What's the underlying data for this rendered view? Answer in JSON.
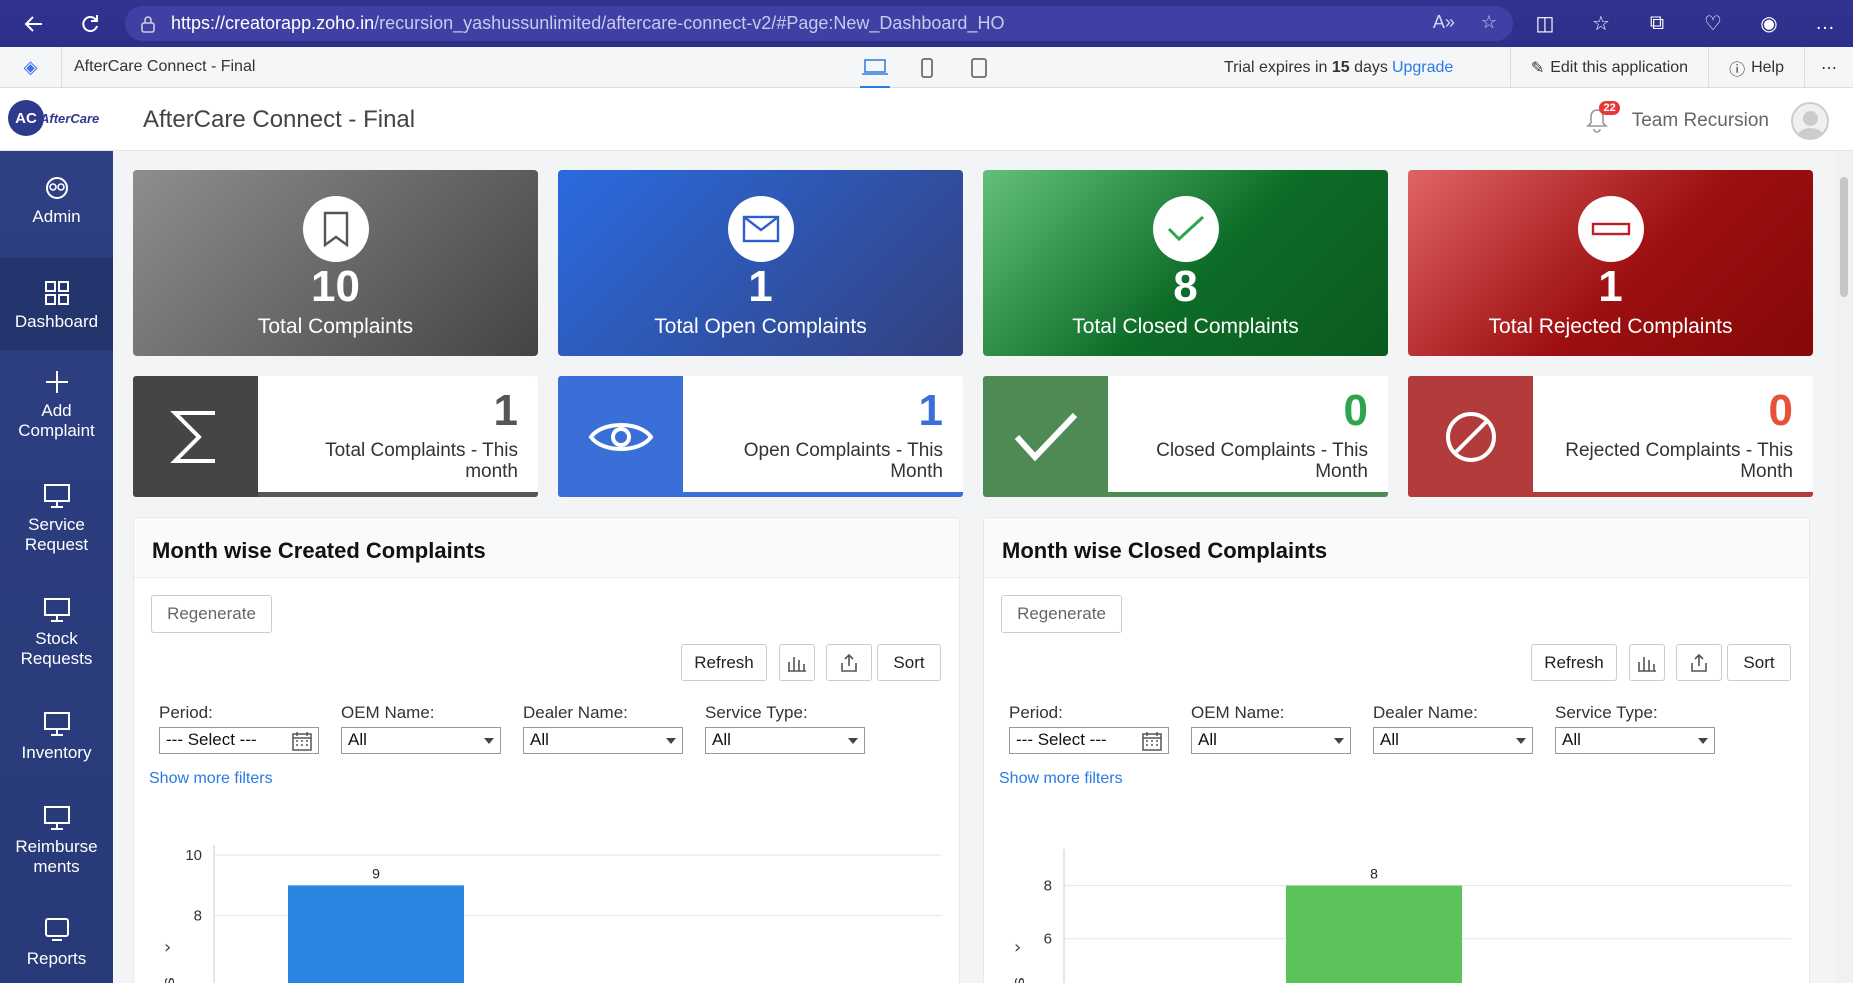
{
  "browser": {
    "url_host": "https://creatorapp.zoho.in",
    "url_path": "/recursion_yashussunlimited/aftercare-connect-v2/#Page:New_Dashboard_HO"
  },
  "zoho_bar": {
    "app_name": "AfterCare Connect - Final",
    "trial_prefix": "Trial expires in ",
    "trial_days": "15",
    "trial_suffix": " days",
    "upgrade": "Upgrade",
    "edit": "Edit this application",
    "help": "Help"
  },
  "header": {
    "logo_text": "AfterCare",
    "title": "AfterCare Connect - Final",
    "notif_count": "22",
    "user": "Team Recursion"
  },
  "sidebar": {
    "items": [
      {
        "label": "Admin",
        "icon": "admin-icon"
      },
      {
        "label": "Dashboard",
        "icon": "dashboard-icon"
      },
      {
        "label": "Add Complaint",
        "icon": "plus-icon"
      },
      {
        "label": "Service Request",
        "icon": "monitor-icon"
      },
      {
        "label": "Stock Requests",
        "icon": "monitor-icon"
      },
      {
        "label": "Inventory",
        "icon": "monitor-icon"
      },
      {
        "label": "Reimburse ments",
        "icon": "monitor-icon"
      },
      {
        "label": "Reports",
        "icon": "report-icon"
      }
    ]
  },
  "summary_cards": [
    {
      "value": "10",
      "label": "Total Complaints",
      "icon": "bookmark-icon"
    },
    {
      "value": "1",
      "label": "Total Open Complaints",
      "icon": "mail-icon"
    },
    {
      "value": "8",
      "label": "Total Closed Complaints",
      "icon": "check-icon"
    },
    {
      "value": "1",
      "label": "Total Rejected Complaints",
      "icon": "minus-icon"
    }
  ],
  "month_cards": [
    {
      "value": "1",
      "label": "Total Complaints - This month",
      "color": "#555555",
      "icon": "sigma-icon"
    },
    {
      "value": "1",
      "label": "Open Complaints - This Month",
      "color": "#3a6fd8",
      "icon": "eye-icon"
    },
    {
      "value": "0",
      "label": "Closed Complaints - This Month",
      "color": "#2ea54d",
      "icon": "check-icon"
    },
    {
      "value": "0",
      "label": "Rejected Complaints - This Month",
      "color": "#e8503a",
      "icon": "ban-icon"
    }
  ],
  "panels": [
    {
      "title": "Month wise Created Complaints",
      "regenerate": "Regenerate",
      "refresh": "Refresh",
      "sort": "Sort",
      "filters": {
        "period_label": "Period:",
        "period_value": "--- Select ---",
        "oem_label": "OEM Name:",
        "oem_value": "All",
        "dealer_label": "Dealer Name:",
        "dealer_value": "All",
        "service_label": "Service Type:",
        "service_value": "All"
      },
      "show_more": "Show more filters"
    },
    {
      "title": "Month wise Closed Complaints",
      "regenerate": "Regenerate",
      "refresh": "Refresh",
      "sort": "Sort",
      "filters": {
        "period_label": "Period:",
        "period_value": "--- Select ---",
        "oem_label": "OEM Name:",
        "oem_value": "All",
        "dealer_label": "Dealer Name:",
        "dealer_value": "All",
        "service_label": "Service Type:",
        "service_value": "All"
      },
      "show_more": "Show more filters"
    }
  ],
  "chart_data": [
    {
      "type": "bar",
      "title": "Month wise Created Complaints",
      "ylabel": "nts",
      "yticks": [
        "10",
        "8"
      ],
      "values": [
        9
      ],
      "color": "#2a86e0",
      "ylim_visible": [
        7,
        10
      ]
    },
    {
      "type": "bar",
      "title": "Month wise Closed Complaints",
      "ylabel": "nts",
      "yticks": [
        "8",
        "6"
      ],
      "values": [
        8
      ],
      "color": "#5cc25a",
      "ylim_visible": [
        5.8,
        9
      ]
    }
  ]
}
